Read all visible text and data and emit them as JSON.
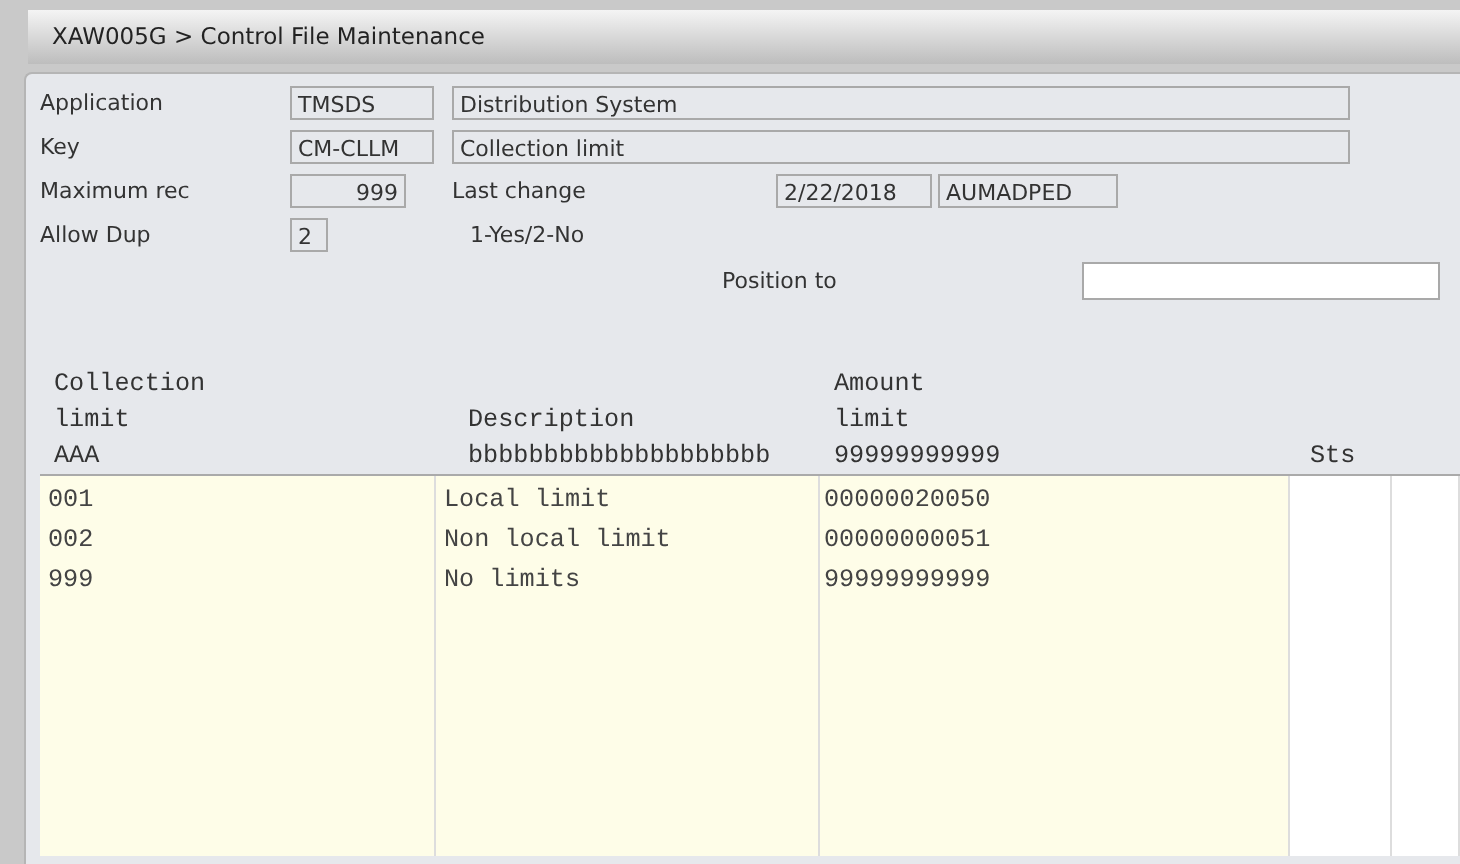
{
  "window": {
    "title": "XAW005G > Control File Maintenance"
  },
  "form": {
    "application": {
      "label": "Application",
      "code": "TMSDS",
      "name": "Distribution System"
    },
    "key": {
      "label": "Key",
      "code": "CM-CLLM",
      "name": "Collection limit"
    },
    "maximum_rec": {
      "label": "Maximum rec",
      "value": "999"
    },
    "last_change": {
      "label": "Last change",
      "date": "2/22/2018",
      "user": "AUMADPED"
    },
    "allow_dup": {
      "label": "Allow Dup",
      "value": "2",
      "hint": "1-Yes/2-No"
    },
    "position_to": {
      "label": "Position to"
    }
  },
  "table": {
    "columns": [
      {
        "heading": [
          "Collection",
          "limit"
        ],
        "pattern": "AAA"
      },
      {
        "heading": [
          "Description"
        ],
        "pattern": "bbbbbbbbbbbbbbbbbbbb"
      },
      {
        "heading": [
          "Amount",
          "limit"
        ],
        "pattern": "99999999999"
      },
      {
        "heading": [
          "Sts"
        ]
      }
    ],
    "rows": [
      {
        "cells": [
          "001",
          "Local limit",
          "00000020050"
        ]
      },
      {
        "cells": [
          "002",
          "Non local limit",
          "00000000051"
        ]
      },
      {
        "cells": [
          "999",
          "No limits",
          "99999999999"
        ]
      }
    ]
  }
}
